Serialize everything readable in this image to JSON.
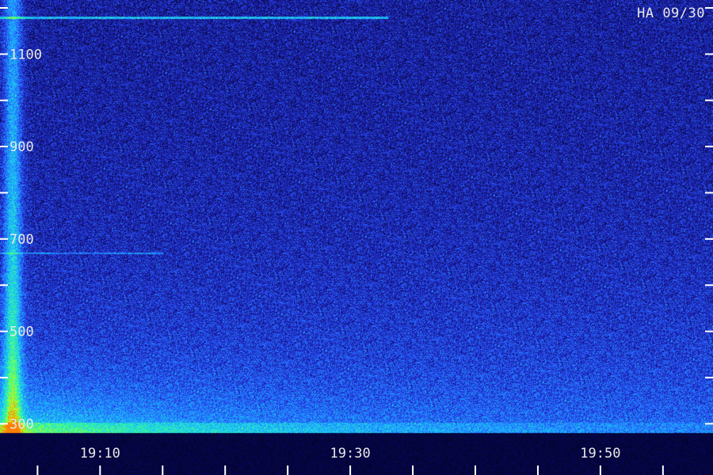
{
  "station_label": "HA 09/30",
  "chart_data": {
    "type": "heatmap",
    "title": "",
    "xlabel": "",
    "ylabel": "",
    "y_ticks": [
      300,
      500,
      700,
      900,
      1100
    ],
    "y_minor_ticks": [
      400,
      600,
      800,
      1000,
      1200
    ],
    "ylim": [
      280,
      1200
    ],
    "x_ticks": [
      "19:10",
      "19:30",
      "19:50"
    ],
    "x_minor_ticks": [
      "19:05",
      "19:15",
      "19:20",
      "19:25",
      "19:35",
      "19:40",
      "19:45",
      "19:55"
    ],
    "xlim": [
      "19:02",
      "19:59"
    ],
    "colormap": [
      "#0a0a40",
      "#1a1aa8",
      "#2a5aff",
      "#1aa8ff",
      "#20e0e0",
      "#40ff80",
      "#c0ff20",
      "#ff8000"
    ],
    "features": [
      {
        "kind": "vertical-band",
        "x": "19:03",
        "y_range": [
          300,
          1200
        ],
        "intensity": 0.9
      },
      {
        "kind": "horizontal-line",
        "y": 1180,
        "x_range": [
          "19:02",
          "19:33"
        ],
        "intensity": 0.8
      },
      {
        "kind": "horizontal-line",
        "y": 670,
        "x_range": [
          "19:02",
          "19:15"
        ],
        "intensity": 0.5
      },
      {
        "kind": "low-frequency-enhancement",
        "x_range": [
          "19:02",
          "19:20"
        ],
        "y_range": [
          300,
          420
        ],
        "intensity": 0.95
      }
    ]
  }
}
